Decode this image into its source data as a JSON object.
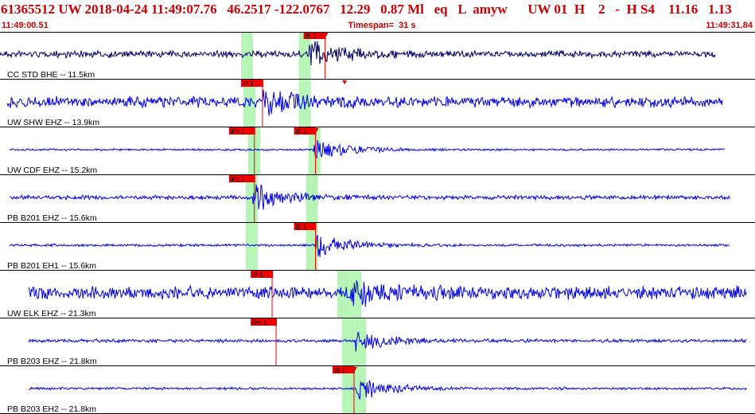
{
  "event": {
    "title": "61365512 UW 2018-04-24 11:49:07.76   46.2517 -122.0767   12.29   0.87 Ml   eq   L  amyw      UW 01  H    2   -  H S4    11.16   1.13",
    "start_time": "11:49:00.51",
    "timespan": "Timespan=  31 s",
    "end_time": "11:49:31.84"
  },
  "colors": {
    "header_text": "#cc0000",
    "trace_primary": "#0000ee",
    "trace_first": "#000066",
    "pick": "#ee0000",
    "window": "#b6f5b6",
    "grid": "#000000"
  },
  "traces": [
    {
      "label": "CC STD BHE -- 11.5km",
      "color": "#000066",
      "amp": 0.16,
      "peak": 0.68,
      "eventSec": 12.8,
      "span": [
        0.0,
        29.7
      ],
      "quietUntil": 0.0,
      "windows": [
        10.0,
        12.4
      ],
      "picks": [
        {
          "label": "iS 1",
          "sec": 12.6,
          "color": "#ee0000",
          "marker": true
        }
      ]
    },
    {
      "label": "UW SHW EHZ -- 13.9km",
      "color": "#0000ee",
      "amp": 0.26,
      "peak": 0.72,
      "eventSec": 10.9,
      "span": [
        0.3,
        30.0
      ],
      "quietUntil": 0.0,
      "windows": [
        10.1,
        12.4
      ],
      "picks": [
        {
          "label": "iP 1",
          "sec": 10.0,
          "color": "#ee0000",
          "marker": false
        },
        {
          "label": "",
          "sec": 14.3,
          "color": "#ee0000",
          "marker": true
        }
      ]
    },
    {
      "label": "UW CDF EHZ -- 15.2km",
      "color": "#0000ee",
      "amp": 0.05,
      "peak": 0.62,
      "eventSec": 13.0,
      "span": [
        0.4,
        30.1
      ],
      "quietUntil": 0.0,
      "windows": [
        10.3,
        12.8
      ],
      "picks": [
        {
          "label": "iPc 1",
          "sec": 9.5,
          "color": "#ee0000",
          "marker": false
        },
        {
          "label": "iS 1",
          "sec": 12.2,
          "color": "#ee0000",
          "marker": true
        }
      ]
    },
    {
      "label": "PB B201 EHZ -- 15.6km",
      "color": "#0000ee",
      "amp": 0.1,
      "peak": 0.62,
      "eventSec": 10.5,
      "span": [
        0.4,
        30.3
      ],
      "quietUntil": 0.0,
      "windows": [
        10.2,
        12.7
      ],
      "picks": [
        {
          "label": "iPc 1",
          "sec": 9.5,
          "color": "#ee0000",
          "marker": false
        }
      ]
    },
    {
      "label": "PB B201 EH1 -- 15.6km",
      "color": "#0000ee",
      "amp": 0.06,
      "peak": 0.62,
      "eventSec": 13.1,
      "span": [
        0.4,
        30.3
      ],
      "quietUntil": 0.0,
      "windows": [
        10.2,
        12.7
      ],
      "picks": [
        {
          "label": "iS 1",
          "sec": 12.2,
          "color": "#ee0000",
          "marker": false
        }
      ]
    },
    {
      "label": "UW ELK EHZ -- 21.3km",
      "color": "#0000ee",
      "amp": 0.32,
      "peak": 0.7,
      "eventSec": 14.6,
      "span": [
        1.2,
        31.0
      ],
      "quietUntil": 0.0,
      "windows": [
        14.0,
        14.5
      ],
      "picks": [
        {
          "label": "iP 1",
          "sec": 10.4,
          "color": "#ee0000",
          "marker": false
        }
      ]
    },
    {
      "label": "PB B203 EHZ -- 21.8km",
      "color": "#0000ee",
      "amp": 0.08,
      "peak": 0.62,
      "eventSec": 14.7,
      "span": [
        1.2,
        31.0
      ],
      "quietUntil": 0.0,
      "windows": [
        14.2,
        14.7
      ],
      "picks": [
        {
          "label": "iPd 1",
          "sec": 10.4,
          "color": "#ee0000",
          "marker": false
        }
      ]
    },
    {
      "label": "PB B203 EH2 -- 21.8km",
      "color": "#0000ee",
      "amp": 0.06,
      "peak": 0.58,
      "eventSec": 14.8,
      "span": [
        1.2,
        31.0
      ],
      "quietUntil": 0.0,
      "windows": [
        14.2,
        14.7
      ],
      "picks": [
        {
          "label": "iS 1",
          "sec": 13.8,
          "color": "#ee0000",
          "marker": true
        }
      ]
    }
  ]
}
